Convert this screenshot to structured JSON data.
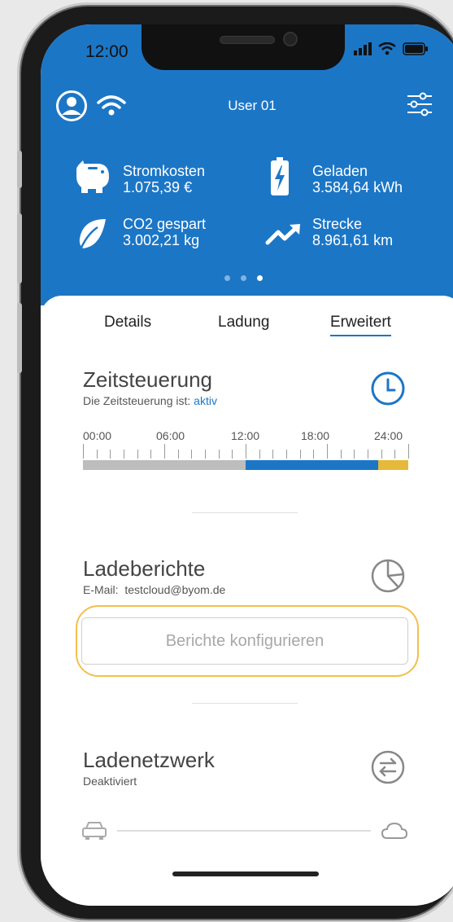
{
  "status_bar": {
    "time": "12:00"
  },
  "header": {
    "user": "User 01"
  },
  "stats": [
    {
      "label": "Stromkosten",
      "value": "1.075,39  €",
      "icon": "piggy-bank-icon"
    },
    {
      "label": "Geladen",
      "value": "3.584,64  kWh",
      "icon": "battery-charging-icon"
    },
    {
      "label": "CO2 gespart",
      "value": "3.002,21  kg",
      "icon": "leaf-icon"
    },
    {
      "label": "Strecke",
      "value": "8.961,61  km",
      "icon": "trend-up-icon"
    }
  ],
  "carousel": {
    "pages": 3,
    "active": 3
  },
  "tabs": [
    {
      "label": "Details"
    },
    {
      "label": "Ladung"
    },
    {
      "label": "Erweitert"
    }
  ],
  "zeitsteuerung": {
    "title": "Zeitsteuerung",
    "subtitle_prefix": "Die Zeitsteuerung ist: ",
    "status": "aktiv",
    "timeline_labels": [
      "00:00",
      "06:00",
      "12:00",
      "18:00",
      "24:00"
    ],
    "segments": [
      {
        "from": 0,
        "to": 12,
        "color": "#bdbdbd"
      },
      {
        "from": 12,
        "to": 21.8,
        "color": "#1c76c6"
      },
      {
        "from": 21.8,
        "to": 24,
        "color": "#e6b93a"
      }
    ]
  },
  "ladeberichte": {
    "title": "Ladeberichte",
    "email_label": "E-Mail:",
    "email": "testcloud@byom.de",
    "button": "Berichte konfigurieren"
  },
  "ladenetzwerk": {
    "title": "Ladenetzwerk",
    "subtitle": "Deaktiviert"
  },
  "colors": {
    "brand_blue": "#1c76c6",
    "highlight_outline": "#f3bf4d",
    "accent_yellow": "#e6b93a"
  }
}
